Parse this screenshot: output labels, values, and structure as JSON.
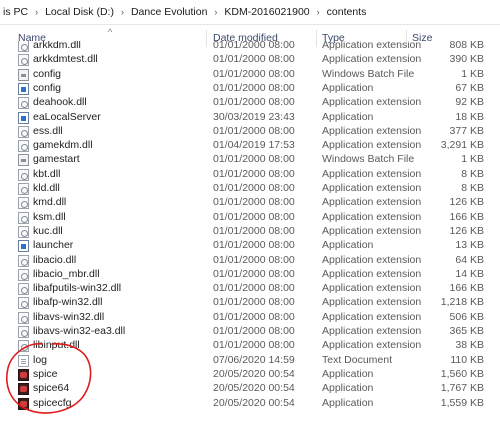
{
  "breadcrumb": [
    "is PC",
    "Local Disk (D:)",
    "Dance Evolution",
    "KDM-2016021900",
    "contents"
  ],
  "columns": {
    "name": "Name",
    "date": "Date modified",
    "type": "Type",
    "size": "Size"
  },
  "colors": {
    "annotation": "#e01b1b",
    "header_text": "#3b4a6b"
  },
  "files": [
    {
      "name": "arkkdm.dll",
      "date": "01/01/2000 08:00",
      "type": "Application extension",
      "size": "808 KB",
      "icon": "dll-icon"
    },
    {
      "name": "arkkdmtest.dll",
      "date": "01/01/2000 08:00",
      "type": "Application extension",
      "size": "390 KB",
      "icon": "dll-icon"
    },
    {
      "name": "config",
      "date": "01/01/2000 08:00",
      "type": "Windows Batch File",
      "size": "1 KB",
      "icon": "batch-file-icon"
    },
    {
      "name": "config",
      "date": "01/01/2000 08:00",
      "type": "Application",
      "size": "67 KB",
      "icon": "application-icon"
    },
    {
      "name": "deahook.dll",
      "date": "01/01/2000 08:00",
      "type": "Application extension",
      "size": "92 KB",
      "icon": "dll-icon"
    },
    {
      "name": "eaLocalServer",
      "date": "30/03/2019 23:43",
      "type": "Application",
      "size": "18 KB",
      "icon": "application-icon"
    },
    {
      "name": "ess.dll",
      "date": "01/01/2000 08:00",
      "type": "Application extension",
      "size": "377 KB",
      "icon": "dll-icon"
    },
    {
      "name": "gamekdm.dll",
      "date": "01/04/2019 17:53",
      "type": "Application extension",
      "size": "3,291 KB",
      "icon": "dll-icon"
    },
    {
      "name": "gamestart",
      "date": "01/01/2000 08:00",
      "type": "Windows Batch File",
      "size": "1 KB",
      "icon": "batch-file-icon"
    },
    {
      "name": "kbt.dll",
      "date": "01/01/2000 08:00",
      "type": "Application extension",
      "size": "8 KB",
      "icon": "dll-icon"
    },
    {
      "name": "kld.dll",
      "date": "01/01/2000 08:00",
      "type": "Application extension",
      "size": "8 KB",
      "icon": "dll-icon"
    },
    {
      "name": "kmd.dll",
      "date": "01/01/2000 08:00",
      "type": "Application extension",
      "size": "126 KB",
      "icon": "dll-icon"
    },
    {
      "name": "ksm.dll",
      "date": "01/01/2000 08:00",
      "type": "Application extension",
      "size": "166 KB",
      "icon": "dll-icon"
    },
    {
      "name": "kuc.dll",
      "date": "01/01/2000 08:00",
      "type": "Application extension",
      "size": "126 KB",
      "icon": "dll-icon"
    },
    {
      "name": "launcher",
      "date": "01/01/2000 08:00",
      "type": "Application",
      "size": "13 KB",
      "icon": "application-icon"
    },
    {
      "name": "libacio.dll",
      "date": "01/01/2000 08:00",
      "type": "Application extension",
      "size": "64 KB",
      "icon": "dll-icon"
    },
    {
      "name": "libacio_mbr.dll",
      "date": "01/01/2000 08:00",
      "type": "Application extension",
      "size": "14 KB",
      "icon": "dll-icon"
    },
    {
      "name": "libafputils-win32.dll",
      "date": "01/01/2000 08:00",
      "type": "Application extension",
      "size": "166 KB",
      "icon": "dll-icon"
    },
    {
      "name": "libafp-win32.dll",
      "date": "01/01/2000 08:00",
      "type": "Application extension",
      "size": "1,218 KB",
      "icon": "dll-icon"
    },
    {
      "name": "libavs-win32.dll",
      "date": "01/01/2000 08:00",
      "type": "Application extension",
      "size": "506 KB",
      "icon": "dll-icon"
    },
    {
      "name": "libavs-win32-ea3.dll",
      "date": "01/01/2000 08:00",
      "type": "Application extension",
      "size": "365 KB",
      "icon": "dll-icon"
    },
    {
      "name": "libinput.dll",
      "date": "01/01/2000 08:00",
      "type": "Application extension",
      "size": "38 KB",
      "icon": "dll-icon"
    },
    {
      "name": "log",
      "date": "07/06/2020 14:59",
      "type": "Text Document",
      "size": "110 KB",
      "icon": "text-document-icon"
    },
    {
      "name": "spice",
      "date": "20/05/2020 00:54",
      "type": "Application",
      "size": "1,560 KB",
      "icon": "spice-icon"
    },
    {
      "name": "spice64",
      "date": "20/05/2020 00:54",
      "type": "Application",
      "size": "1,767 KB",
      "icon": "spice-icon"
    },
    {
      "name": "spicecfg",
      "date": "20/05/2020 00:54",
      "type": "Application",
      "size": "1,559 KB",
      "icon": "spice-icon"
    }
  ]
}
